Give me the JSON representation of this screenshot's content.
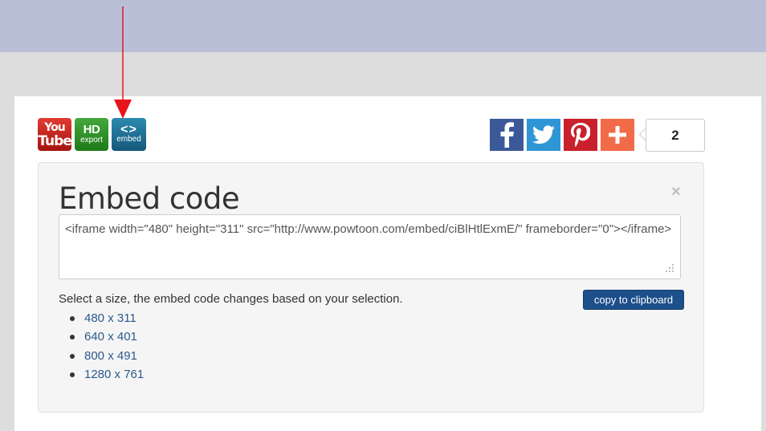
{
  "badges": {
    "youtube": {
      "line1": "You",
      "line2": "Tube"
    },
    "hd_export": {
      "line1": "HD",
      "line2": "export"
    },
    "embed": {
      "line1": "<>",
      "line2": "embed"
    }
  },
  "share": {
    "facebook_icon": "facebook-f",
    "twitter_icon": "twitter-bird",
    "pinterest_icon": "pinterest-p",
    "plus_icon": "plus",
    "count": "2"
  },
  "embed_panel": {
    "title": "Embed code",
    "close": "×",
    "code": "<iframe width=\"480\" height=\"311\" src=\"http://www.powtoon.com/embed/ciBlHtlExmE/\" frameborder=\"0\"></iframe>",
    "instruction": "Select a size, the embed code changes based on your selection.",
    "copy_label": "copy to clipboard",
    "sizes": [
      "480 x 311",
      "640 x 401",
      "800 x 491",
      "1280 x 761"
    ]
  },
  "colors": {
    "top_band": "#babfd8",
    "arrow": "#e8141b",
    "copy_button": "#1d4f8a",
    "link": "#2a5a8e"
  }
}
